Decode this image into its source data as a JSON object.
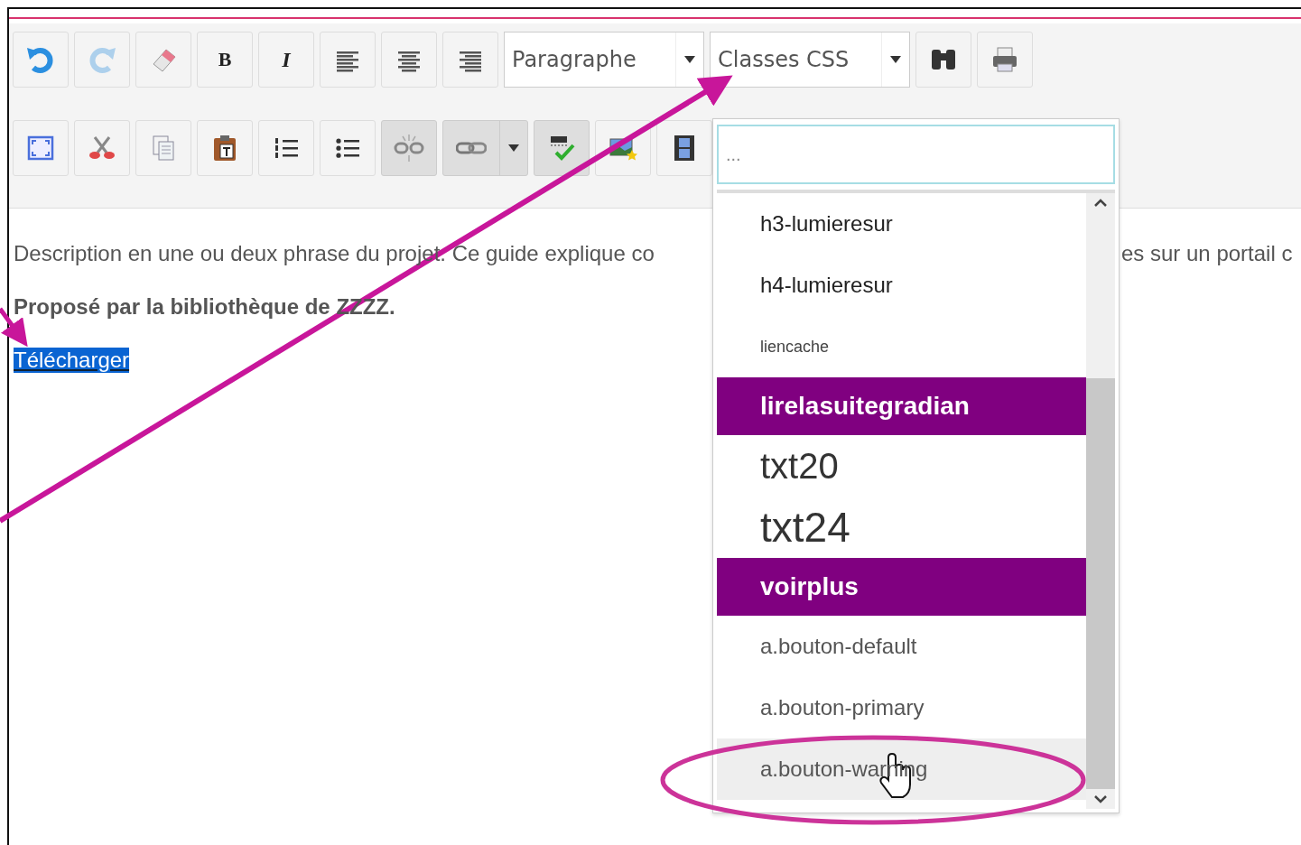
{
  "toolbar": {
    "rows": [
      [
        {
          "kind": "undo",
          "disabled": false,
          "pressed": false
        },
        {
          "kind": "redo",
          "disabled": true,
          "pressed": false
        },
        {
          "kind": "eraser",
          "disabled": false,
          "pressed": false
        },
        {
          "kind": "bold",
          "label": "B",
          "disabled": false,
          "pressed": false
        },
        {
          "kind": "italic",
          "label": "I",
          "disabled": false,
          "pressed": false
        },
        {
          "kind": "align-left",
          "disabled": false,
          "pressed": false
        },
        {
          "kind": "align-center",
          "disabled": false,
          "pressed": false
        },
        {
          "kind": "align-right",
          "disabled": false,
          "pressed": false
        },
        {
          "kind": "select",
          "value": "Paragraphe",
          "disabled": false,
          "pressed": false
        },
        {
          "kind": "select",
          "value": "Classes CSS",
          "disabled": false,
          "pressed": false
        },
        {
          "kind": "find",
          "disabled": false,
          "pressed": false
        },
        {
          "kind": "print",
          "disabled": false,
          "pressed": false
        }
      ],
      [
        {
          "kind": "fullscreen",
          "disabled": false,
          "pressed": false
        },
        {
          "kind": "cut",
          "disabled": false,
          "pressed": false
        },
        {
          "kind": "copy",
          "disabled": false,
          "pressed": false
        },
        {
          "kind": "paste",
          "disabled": false,
          "pressed": false
        },
        {
          "kind": "numbered-list",
          "disabled": false,
          "pressed": false
        },
        {
          "kind": "bullet-list",
          "disabled": false,
          "pressed": false
        },
        {
          "kind": "unlink",
          "disabled": false,
          "pressed": true
        },
        {
          "kind": "link-split",
          "disabled": false,
          "pressed": true
        },
        {
          "kind": "spellcheck",
          "disabled": false,
          "pressed": true
        },
        {
          "kind": "image",
          "disabled": false,
          "pressed": false
        },
        {
          "kind": "film",
          "disabled": false,
          "pressed": false
        }
      ]
    ]
  },
  "content": {
    "description": {
      "left": "Description en une ou deux phrase du projet. Ce guide explique co",
      "right": "es sur un portail c"
    },
    "credit": "Proposé par la bibliothèque de ZZZZ.",
    "link": {
      "text": "Télécharger",
      "selected": true
    }
  },
  "style_menu": {
    "search": {
      "placeholder": "..."
    },
    "items": [
      {
        "label": "h3-lumieresur",
        "kind": "plain",
        "hovered": false
      },
      {
        "label": "h4-lumieresur",
        "kind": "plain",
        "hovered": false
      },
      {
        "label": "liencache",
        "kind": "small",
        "hovered": false
      },
      {
        "label": "lirelasuitegradian",
        "kind": "banner",
        "hovered": false
      },
      {
        "label": "txt20",
        "kind": "large",
        "hovered": false
      },
      {
        "label": "txt24",
        "kind": "xlarge",
        "hovered": false
      },
      {
        "label": "voirplus",
        "kind": "banner",
        "hovered": false
      },
      {
        "label": "a.bouton-default",
        "kind": "muted",
        "hovered": false
      },
      {
        "label": "a.bouton-primary",
        "kind": "muted",
        "hovered": false
      },
      {
        "label": "a.bouton-warning",
        "kind": "muted",
        "hovered": true
      }
    ]
  }
}
